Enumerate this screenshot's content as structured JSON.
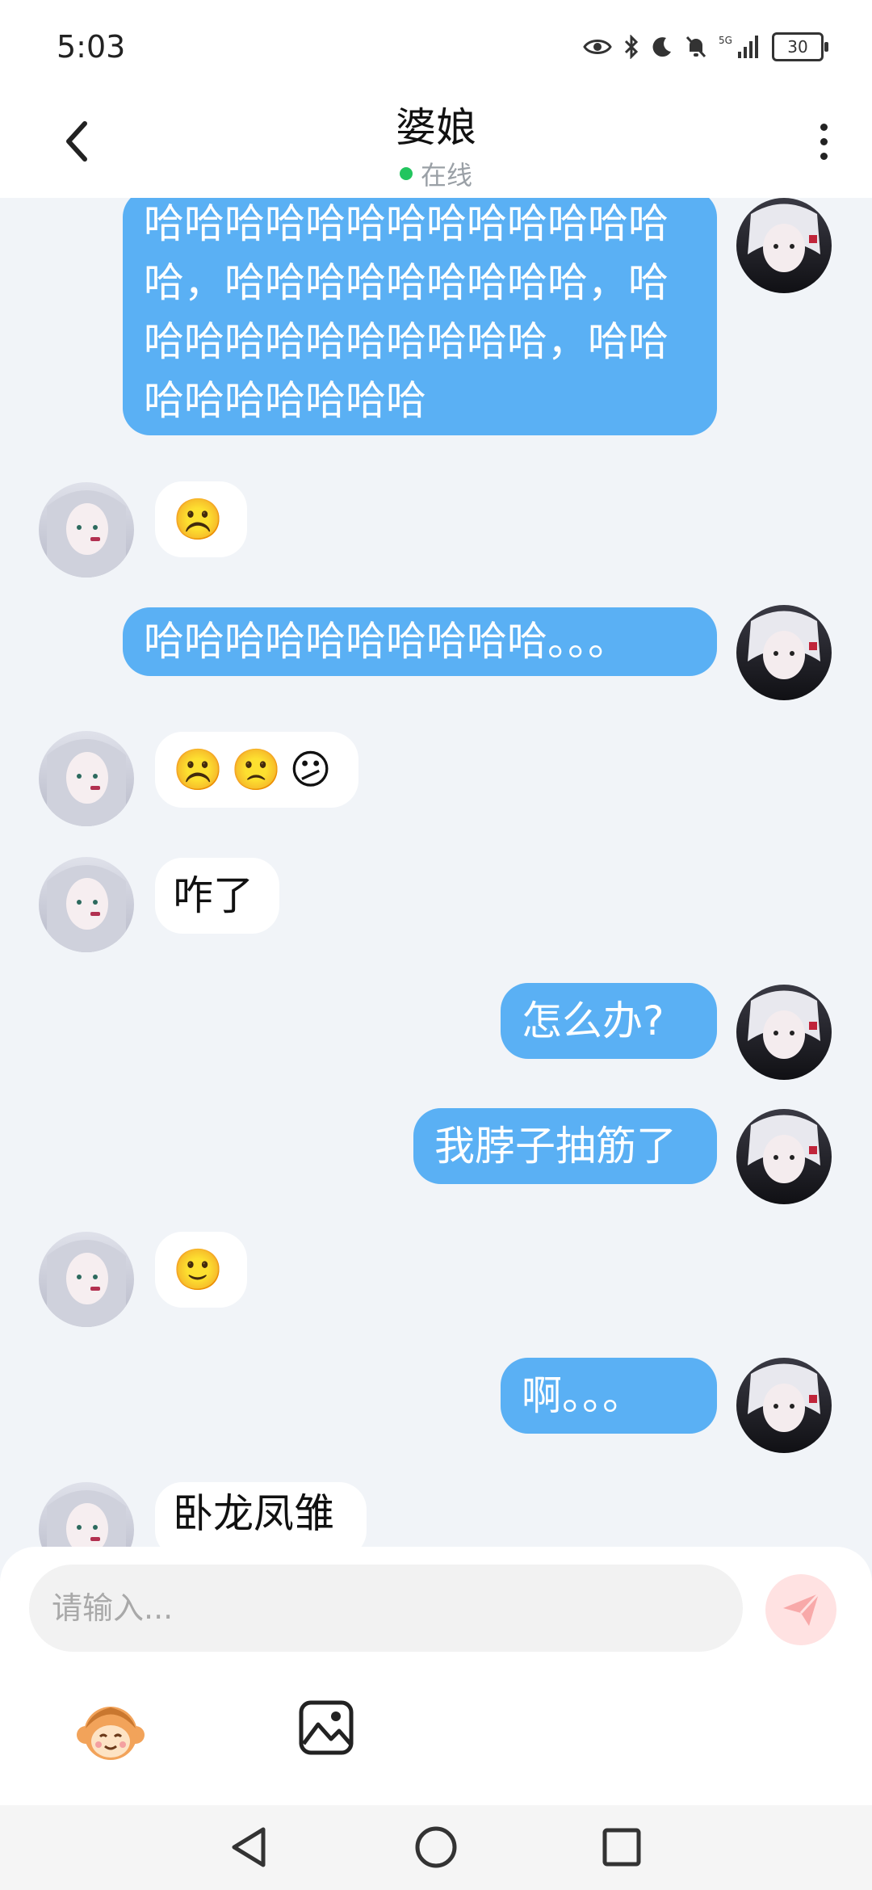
{
  "status": {
    "time": "5:03",
    "battery": "30"
  },
  "header": {
    "title": "婆娘",
    "presence": "在线"
  },
  "messages": [
    {
      "from": "me",
      "text": "哈哈哈哈哈哈哈哈哈哈哈哈哈哈，哈哈哈哈哈哈哈哈哈，哈哈哈哈哈哈哈哈哈哈哈，哈哈哈哈哈哈哈哈哈"
    },
    {
      "from": "other",
      "emojis": [
        "☹️"
      ]
    },
    {
      "from": "me",
      "text": "哈哈哈哈哈哈哈哈哈哈。。。"
    },
    {
      "from": "other",
      "emojis": [
        "☹️",
        "🙁",
        "😕"
      ]
    },
    {
      "from": "other",
      "text": "咋了"
    },
    {
      "from": "me",
      "text": "怎么办?"
    },
    {
      "from": "me",
      "text": "我脖子抽筋了"
    },
    {
      "from": "other",
      "emojis": [
        "🙂"
      ]
    },
    {
      "from": "me",
      "text": "啊。。。"
    },
    {
      "from": "other",
      "text": "卧龙凤雏"
    }
  ],
  "composer": {
    "placeholder": "请输入..."
  },
  "toolbar": {
    "sticker_icon": "monkey-sticker-icon",
    "image_icon": "image-icon"
  },
  "colors": {
    "my_bubble": "#5ab0f4",
    "other_bubble": "#ffffff",
    "background": "#f1f4f8",
    "online": "#22c55e"
  }
}
